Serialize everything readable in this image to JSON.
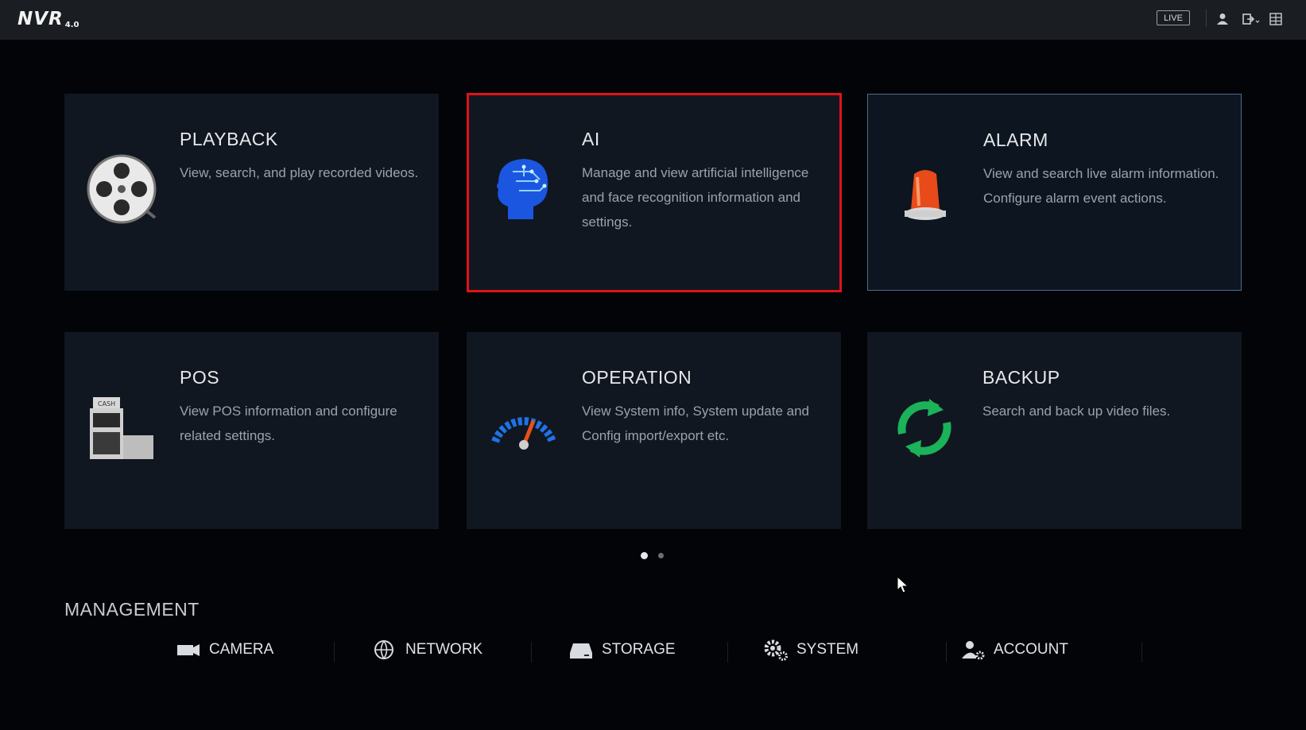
{
  "topbar": {
    "logo_text": "NVR",
    "logo_version": "4.0",
    "live_label": "LIVE",
    "icons": [
      "user-icon",
      "logout-icon",
      "menu-grid-icon"
    ]
  },
  "cards": [
    {
      "title": "PLAYBACK",
      "desc": "View, search, and play recorded videos.",
      "icon": "film-reel-icon"
    },
    {
      "title": "AI",
      "desc": "Manage and view artificial intelligence and face recognition information and settings.",
      "icon": "ai-head-icon",
      "selected": true
    },
    {
      "title": "ALARM",
      "desc": "View and search live alarm information. Configure alarm event actions.",
      "icon": "alarm-light-icon",
      "hovered": true
    },
    {
      "title": "POS",
      "desc": "View POS information and configure related settings.",
      "icon": "cash-register-icon"
    },
    {
      "title": "OPERATION",
      "desc": "View System info, System update and Config import/export etc.",
      "icon": "gauge-icon"
    },
    {
      "title": "BACKUP",
      "desc": "Search and back up video files.",
      "icon": "refresh-arrows-icon"
    }
  ],
  "pagination": {
    "pages": 2,
    "current": 1
  },
  "management": {
    "title": "MANAGEMENT",
    "items": [
      {
        "label": "CAMERA",
        "icon": "camera-icon"
      },
      {
        "label": "NETWORK",
        "icon": "globe-icon"
      },
      {
        "label": "STORAGE",
        "icon": "hard-drive-icon"
      },
      {
        "label": "SYSTEM",
        "icon": "gears-icon"
      },
      {
        "label": "ACCOUNT",
        "icon": "user-gear-icon"
      }
    ]
  },
  "colors": {
    "selection_border": "#e0121a",
    "card_bg": "#111720",
    "hover_border": "#4e6a8c",
    "background": "#020407"
  }
}
